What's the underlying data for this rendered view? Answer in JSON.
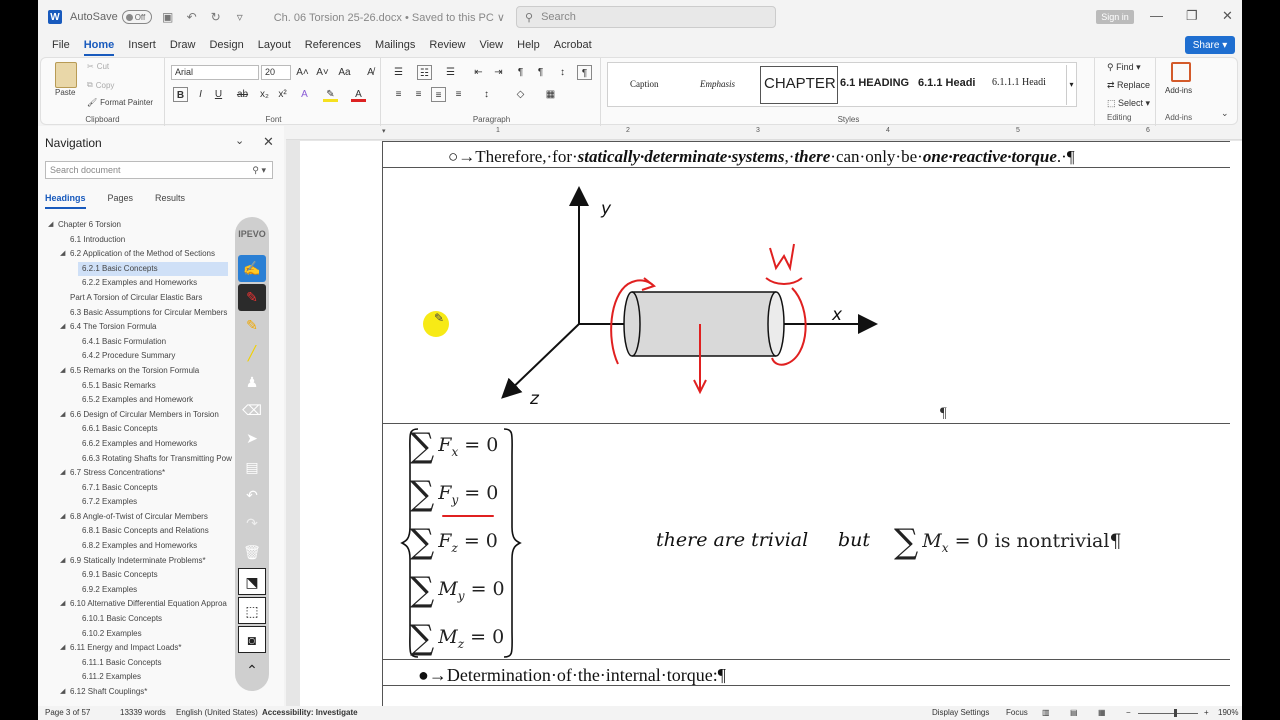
{
  "titlebar": {
    "autosave_label": "AutoSave",
    "autosave_state": "Off",
    "doc_title": "Ch. 06 Torsion 25-26.docx • Saved to this PC ∨",
    "search_placeholder": "Search",
    "signin_label": "Sign in"
  },
  "menu": {
    "tabs": [
      "File",
      "Home",
      "Insert",
      "Draw",
      "Design",
      "Layout",
      "References",
      "Mailings",
      "Review",
      "View",
      "Help",
      "Acrobat"
    ],
    "share_label": "Share"
  },
  "ribbon": {
    "clipboard": {
      "paste": "Paste",
      "cut": "Cut",
      "copy": "Copy",
      "format_painter": "Format Painter",
      "label": "Clipboard"
    },
    "font": {
      "family": "Arial",
      "size": "20",
      "label": "Font",
      "bold": "B",
      "italic": "I",
      "underline": "U",
      "strike": "ab",
      "sub": "x₂",
      "sup": "x²"
    },
    "paragraph": {
      "label": "Paragraph"
    },
    "styles": {
      "label": "Styles",
      "items": [
        "Caption",
        "Emphasis",
        "CHAPTER",
        "6.1 HEADING",
        "6.1.1 Headi",
        "6.1.1.1 Headi"
      ]
    },
    "editing": {
      "find": "Find",
      "replace": "Replace",
      "select": "Select",
      "label": "Editing"
    },
    "addins": {
      "label": "Add-ins",
      "group": "Add-ins"
    }
  },
  "navigation": {
    "title": "Navigation",
    "search_placeholder": "Search document",
    "tabs": [
      "Headings",
      "Pages",
      "Results"
    ],
    "items": [
      {
        "text": "Chapter 6 Torsion",
        "level": 0,
        "arrow": "◢"
      },
      {
        "text": "6.1 Introduction",
        "level": 1,
        "arrow": ""
      },
      {
        "text": "6.2 Application of the Method of Sections",
        "level": 1,
        "arrow": "◢"
      },
      {
        "text": "6.2.1 Basic Concepts",
        "level": 2,
        "arrow": "",
        "selected": true
      },
      {
        "text": "6.2.2 Examples and Homeworks",
        "level": 2,
        "arrow": ""
      },
      {
        "text": "Part A Torsion of Circular Elastic Bars",
        "level": 1,
        "arrow": ""
      },
      {
        "text": "6.3 Basic Assumptions for Circular Members",
        "level": 1,
        "arrow": ""
      },
      {
        "text": "6.4 The Torsion Formula",
        "level": 1,
        "arrow": "◢"
      },
      {
        "text": "6.4.1 Basic Formulation",
        "level": 2,
        "arrow": ""
      },
      {
        "text": "6.4.2 Procedure Summary",
        "level": 2,
        "arrow": ""
      },
      {
        "text": "6.5 Remarks on the Torsion Formula",
        "level": 1,
        "arrow": "◢"
      },
      {
        "text": "6.5.1 Basic Remarks",
        "level": 2,
        "arrow": ""
      },
      {
        "text": "6.5.2 Examples and Homework",
        "level": 2,
        "arrow": ""
      },
      {
        "text": "6.6 Design of Circular Members in Torsion",
        "level": 1,
        "arrow": "◢"
      },
      {
        "text": "6.6.1 Basic Concepts",
        "level": 2,
        "arrow": ""
      },
      {
        "text": "6.6.2 Examples and Homeworks",
        "level": 2,
        "arrow": ""
      },
      {
        "text": "6.6.3 Rotating Shafts for Transmitting Pow",
        "level": 2,
        "arrow": ""
      },
      {
        "text": "6.7 Stress Concentrations*",
        "level": 1,
        "arrow": "◢"
      },
      {
        "text": "6.7.1 Basic Concepts",
        "level": 2,
        "arrow": ""
      },
      {
        "text": "6.7.2 Examples",
        "level": 2,
        "arrow": ""
      },
      {
        "text": "6.8 Angle-of-Twist of Circular Members",
        "level": 1,
        "arrow": "◢"
      },
      {
        "text": "6.8.1 Basic Concepts and Relations",
        "level": 2,
        "arrow": ""
      },
      {
        "text": "6.8.2 Examples and Homeworks",
        "level": 2,
        "arrow": ""
      },
      {
        "text": "6.9 Statically Indeterminate Problems*",
        "level": 1,
        "arrow": "◢"
      },
      {
        "text": "6.9.1 Basic Concepts",
        "level": 2,
        "arrow": ""
      },
      {
        "text": "6.9.2 Examples",
        "level": 2,
        "arrow": ""
      },
      {
        "text": "6.10 Alternative Differential Equation Approa",
        "level": 1,
        "arrow": "◢"
      },
      {
        "text": "6.10.1 Basic Concepts",
        "level": 2,
        "arrow": ""
      },
      {
        "text": "6.10.2 Examples",
        "level": 2,
        "arrow": ""
      },
      {
        "text": "6.11 Energy and Impact Loads*",
        "level": 1,
        "arrow": "◢"
      },
      {
        "text": "6.11.1 Basic Concepts",
        "level": 2,
        "arrow": ""
      },
      {
        "text": "6.11.2 Examples",
        "level": 2,
        "arrow": ""
      },
      {
        "text": "6.12 Shaft Couplings*",
        "level": 1,
        "arrow": "◢"
      }
    ]
  },
  "ipevo": {
    "logo": "IPEVO"
  },
  "document": {
    "line1_pre": "○→Therefore,·for·",
    "line1_em1": "statically·determinate·systems",
    "line1_mid": ",·",
    "line1_em2": "there",
    "line1_mid2": "·can·only·be·",
    "line1_em3": "one·reactive·torque",
    "line1_end": ".·¶",
    "axis_y": "y",
    "axis_x": "x",
    "axis_z": "z",
    "pilcrow": "¶",
    "equations": [
      "F",
      "F",
      "F",
      "M",
      "M"
    ],
    "eq_subs": [
      "x",
      "y",
      "z",
      "y",
      "z"
    ],
    "eq_rhs": "= 0",
    "trivial_text": "there are trivial",
    "but_text": "but",
    "moment_sym": "M",
    "moment_sub": "x",
    "moment_rhs": "= 0 is nontrivial¶",
    "bottom_text": "●→Determination·of·the·internal·torque:¶"
  },
  "status": {
    "page": "Page 3 of 57",
    "words": "13339 words",
    "language": "English (United States)",
    "accessibility": "Accessibility: Investigate",
    "display": "Display Settings",
    "focus": "Focus",
    "zoom": "190%"
  }
}
